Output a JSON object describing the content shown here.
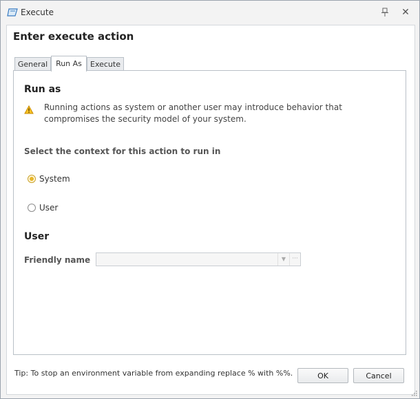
{
  "window": {
    "title": "Execute",
    "icons": {
      "app": "execute-icon",
      "pin": "pin-icon",
      "close": "close-icon"
    }
  },
  "dialog": {
    "title": "Enter execute action",
    "tabs": [
      {
        "label": "General",
        "active": false
      },
      {
        "label": "Run As",
        "active": true
      },
      {
        "label": "Execute",
        "active": false
      }
    ]
  },
  "run_as": {
    "heading": "Run as",
    "warning_icon": "warning-icon",
    "warning_text": "Running actions as system or another user may introduce behavior that compromises the security model of your system.",
    "context_label": "Select the context for this action to run in",
    "options": [
      {
        "label": "System",
        "selected": true
      },
      {
        "label": "User",
        "selected": false
      }
    ]
  },
  "user": {
    "heading": "User",
    "friendly_name_label": "Friendly name",
    "friendly_name_value": "",
    "enabled": false
  },
  "footer": {
    "tip": "Tip: To stop an environment variable from expanding replace % with %%.",
    "ok_label": "OK",
    "cancel_label": "Cancel"
  },
  "colors": {
    "radio_selected": "#e8b62a",
    "warning": "#f0b400",
    "border": "#b9c0c7"
  }
}
